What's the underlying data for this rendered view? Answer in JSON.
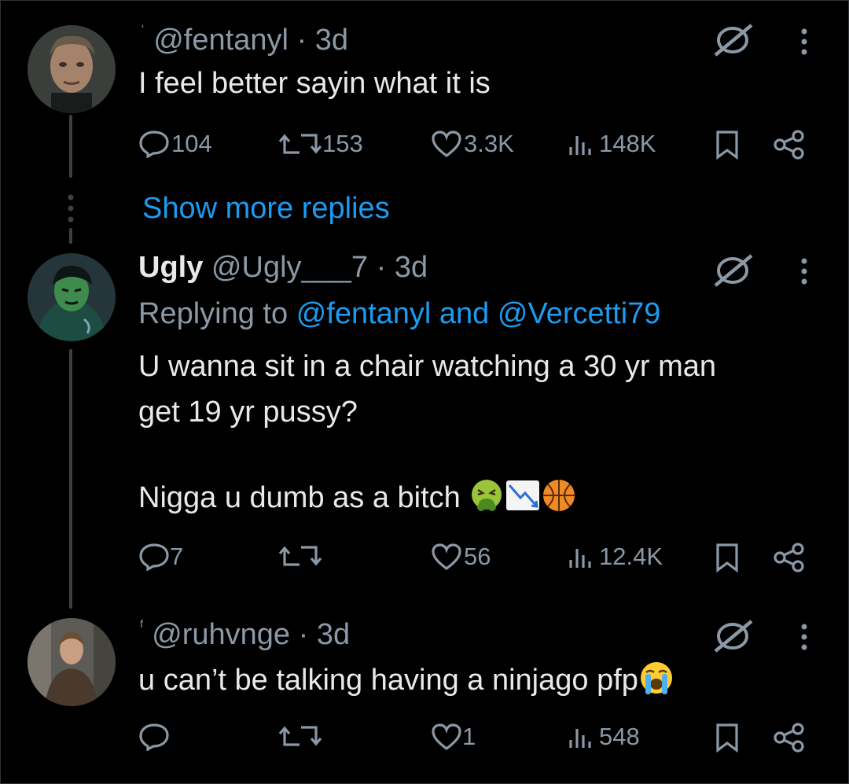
{
  "tweets": [
    {
      "display_name": "",
      "handle": "@fentanyl",
      "time": "3d",
      "text_lines": [
        "I feel better sayin what it is"
      ],
      "replies": "104",
      "reposts": "153",
      "likes": "3.3K",
      "views": "148K"
    },
    {
      "display_name": "Ugly",
      "handle": "@Ugly___7",
      "time": "3d",
      "replying_prefix": "Replying to",
      "replying_mentions": "@fentanyl and @Vercetti79",
      "text_lines": [
        "U wanna sit in a chair watching a 30 yr man",
        "get 19 yr pussy?",
        "",
        "Nigga u dumb as a bitch"
      ],
      "replies": "7",
      "reposts": "",
      "likes": "56",
      "views": "12.4K"
    },
    {
      "display_name": "",
      "handle": "@ruhvnge",
      "time": "3d",
      "text_lines": [
        "u can’t be talking having a ninjago pfp"
      ],
      "replies": "",
      "reposts": "",
      "likes": "1",
      "views": "548"
    }
  ],
  "show_more_label": "Show more replies",
  "separator": "·",
  "colors": {
    "background": "#000000",
    "text": "#e7e9ea",
    "muted": "#8b98a5",
    "link": "#1d9bf0"
  },
  "icons": [
    "reply-icon",
    "repost-icon",
    "like-icon",
    "views-icon",
    "bookmark-icon",
    "share-icon",
    "grok-icon",
    "more-icon"
  ],
  "emojis": [
    "nauseated-face-emoji",
    "chart-decreasing-emoji",
    "basketball-emoji",
    "loudly-crying-face-emoji"
  ]
}
